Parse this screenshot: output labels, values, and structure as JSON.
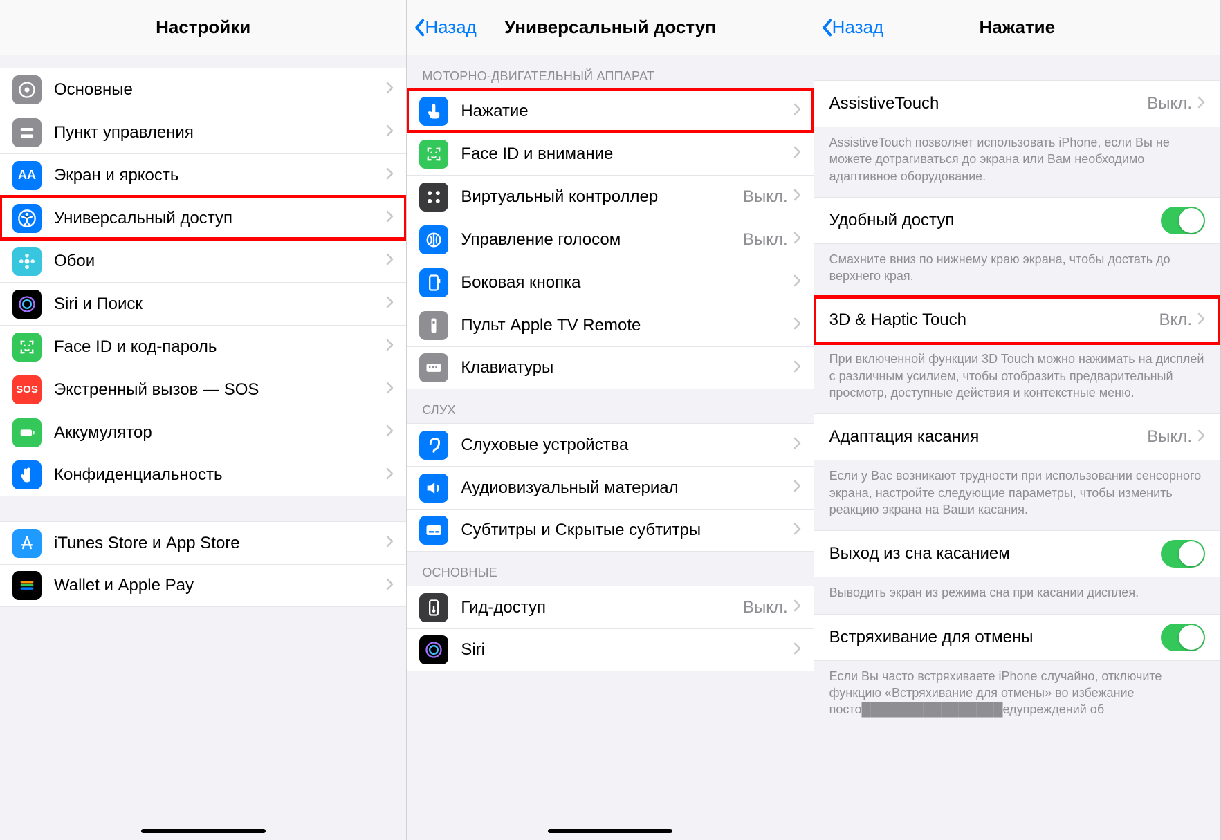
{
  "screen1": {
    "title": "Настройки",
    "items": [
      {
        "label": "Основные",
        "icon": "gear",
        "bg": "#8e8e93"
      },
      {
        "label": "Пункт управления",
        "icon": "toggles",
        "bg": "#8e8e93"
      },
      {
        "label": "Экран и яркость",
        "icon": "AA",
        "bg": "#007aff"
      },
      {
        "label": "Универсальный доступ",
        "icon": "accessibility",
        "bg": "#007aff",
        "highlight": true
      },
      {
        "label": "Обои",
        "icon": "flower",
        "bg": "#38c5de"
      },
      {
        "label": "Siri и Поиск",
        "icon": "siri",
        "bg": "#000000"
      },
      {
        "label": "Face ID и код-пароль",
        "icon": "faceid",
        "bg": "#34c759"
      },
      {
        "label": "Экстренный вызов — SOS",
        "icon": "SOS",
        "bg": "#ff3b30"
      },
      {
        "label": "Аккумулятор",
        "icon": "battery",
        "bg": "#34c759"
      },
      {
        "label": "Конфиденциальность",
        "icon": "hand",
        "bg": "#007aff"
      }
    ],
    "group2": [
      {
        "label": "iTunes Store и App Store",
        "icon": "appstore",
        "bg": "#1f9bff"
      },
      {
        "label": "Wallet и Apple Pay",
        "icon": "wallet",
        "bg": "#000000"
      }
    ]
  },
  "screen2": {
    "back": "Назад",
    "title": "Универсальный доступ",
    "section_motor": "МОТОРНО-ДВИГАТЕЛЬНЫЙ АППАРАТ",
    "motor_items": [
      {
        "label": "Нажатие",
        "icon": "touch",
        "bg": "#007aff",
        "highlight": true
      },
      {
        "label": "Face ID и внимание",
        "icon": "faceid2",
        "bg": "#34c759"
      },
      {
        "label": "Виртуальный контроллер",
        "icon": "dots",
        "bg": "#3a3a3c",
        "value": "Выкл."
      },
      {
        "label": "Управление голосом",
        "icon": "voice",
        "bg": "#007aff",
        "value": "Выкл."
      },
      {
        "label": "Боковая кнопка",
        "icon": "sidebtn",
        "bg": "#007aff"
      },
      {
        "label": "Пульт Apple TV Remote",
        "icon": "remote",
        "bg": "#8e8e93"
      },
      {
        "label": "Клавиатуры",
        "icon": "keyboard",
        "bg": "#8e8e93"
      }
    ],
    "section_hearing": "СЛУХ",
    "hearing_items": [
      {
        "label": "Слуховые устройства",
        "icon": "hearing",
        "bg": "#007aff"
      },
      {
        "label": "Аудиовизуальный материал",
        "icon": "audiovisual",
        "bg": "#007aff"
      },
      {
        "label": "Субтитры и Скрытые субтитры",
        "icon": "subtitles",
        "bg": "#007aff"
      }
    ],
    "section_general": "ОСНОВНЫЕ",
    "general_items": [
      {
        "label": "Гид-доступ",
        "icon": "guided",
        "bg": "#3a3a3c",
        "value": "Выкл."
      },
      {
        "label": "Siri",
        "icon": "siri",
        "bg": "#000000"
      }
    ]
  },
  "screen3": {
    "back": "Назад",
    "title": "Нажатие",
    "rows": {
      "assistive": {
        "label": "AssistiveTouch",
        "value": "Выкл."
      },
      "assistive_desc": "AssistiveTouch позволяет использовать iPhone, если Вы не можете дотрагиваться до экрана или Вам необходимо адаптивное оборудование.",
      "reachability": {
        "label": "Удобный доступ"
      },
      "reachability_desc": "Смахните вниз по нижнему краю экрана, чтобы достать до верхнего края.",
      "haptic": {
        "label": "3D & Haptic Touch",
        "value": "Вкл."
      },
      "haptic_desc": "При включенной функции 3D Touch можно нажимать на дисплей с различным усилием, чтобы отобразить предварительный просмотр, доступные действия и контекстные меню.",
      "touch_accom": {
        "label": "Адаптация касания",
        "value": "Выкл."
      },
      "touch_accom_desc": "Если у Вас возникают трудности при использовании сенсорного экрана, настройте следующие параметры, чтобы изменить реакцию экрана на Ваши касания.",
      "tap_wake": {
        "label": "Выход из сна касанием"
      },
      "tap_wake_desc": "Выводить экран из режима сна при касании дисплея.",
      "shake": {
        "label": "Встряхивание для отмены"
      },
      "shake_desc": "Если Вы часто встряхиваете iPhone случайно, отключите функцию «Встряхивание для отмены» во избежание посто████████████████едупреждений об"
    }
  }
}
